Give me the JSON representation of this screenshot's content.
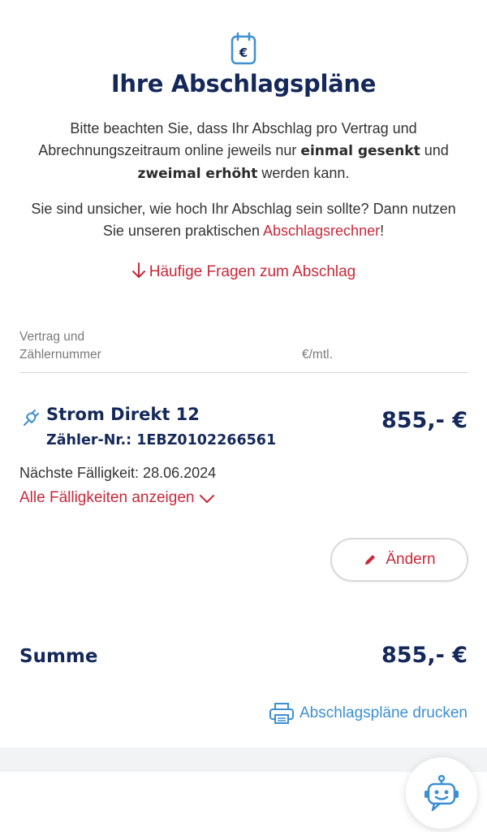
{
  "header": {
    "icon": "euro-calendar-icon",
    "title": "Ihre Abschlagspläne"
  },
  "intro": {
    "p1_part1": "Bitte beachten Sie, dass Ihr Abschlag pro Vertrag und Abrechnungszeitraum online jeweils nur ",
    "p1_bold1": "einmal gesenkt",
    "p1_part2": " und ",
    "p1_bold2": "zweimal erhöht",
    "p1_part3": " werden kann.",
    "p2_part1": "Sie sind unsicher, wie hoch Ihr Abschlag sein sollte? Dann nutzen Sie unseren praktischen ",
    "p2_link": "Abschlagsrechner",
    "p2_part2": "!"
  },
  "faq_link": {
    "icon": "arrow-down-icon",
    "label": "Häufige Fragen zum Abschlag"
  },
  "table_header": {
    "contract_col_line1": "Vertrag und",
    "contract_col_line2": "Zählernummer",
    "amount_col": "€/mtl."
  },
  "contract": {
    "icon": "electric-plug-icon",
    "name": "Strom Direkt 12",
    "meter": "Zähler-Nr.: 1EBZ0102266561",
    "amount": "855,- €",
    "next_due": "Nächste Fälligkeit: 28.06.2024",
    "show_all_label": "Alle Fälligkeiten anzeigen",
    "show_all_icon": "chevron-down-icon",
    "edit_label": "Ändern",
    "edit_icon": "pencil-icon"
  },
  "summary": {
    "label": "Summe",
    "amount": "855,- €"
  },
  "print": {
    "icon": "printer-icon",
    "label": "Abschlagspläne drucken"
  },
  "chatbot": {
    "icon": "chatbot-robot-icon"
  },
  "colors": {
    "navy": "#14285a",
    "red": "#c8283a",
    "blue": "#3d8fd2"
  }
}
